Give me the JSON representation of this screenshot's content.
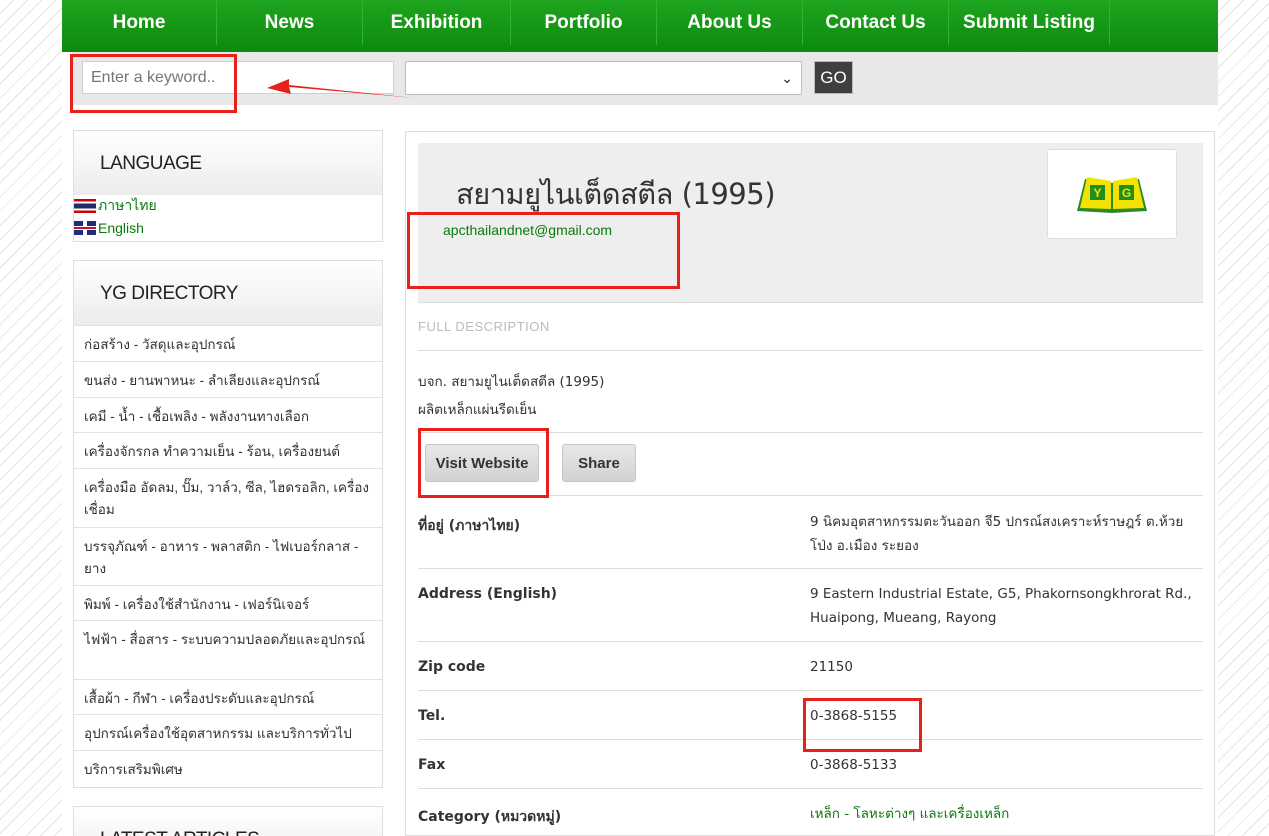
{
  "nav": {
    "items": [
      "Home",
      "News",
      "Exhibition",
      "Portfolio",
      "About Us",
      "Contact Us",
      "Submit Listing"
    ]
  },
  "search": {
    "placeholder": "Enter a keyword..",
    "go_label": "GO",
    "category_value": ""
  },
  "sidebar": {
    "language": {
      "title": "LANGUAGE",
      "items": [
        "ภาษาไทย",
        "English"
      ]
    },
    "directory": {
      "title": "YG DIRECTORY",
      "items": [
        "ก่อสร้าง - วัสดุและอุปกรณ์",
        "ขนส่ง - ยานพาหนะ - ลำเลียงและอุปกรณ์",
        "เคมี - น้ำ - เชื้อเพลิง - พลังงานทางเลือก",
        "เครื่องจักรกล ทำความเย็น - ร้อน, เครื่องยนต์",
        "เครื่องมือ อัดลม, ปั๊ม, วาล์ว, ซีล, ไฮดรอลิก, เครื่องเชื่อม",
        "บรรจุภัณฑ์ - อาหาร - พลาสติก - ไฟเบอร์กลาส - ยาง",
        "พิมพ์ - เครื่องใช้สำนักงาน - เฟอร์นิเจอร์",
        "ไฟฟ้า - สื่อสาร - ระบบความปลอดภัยและอุปกรณ์",
        "เสื้อผ้า - กีฬา - เครื่องประดับและอุปกรณ์",
        "อุปกรณ์เครื่องใช้อุตสาหกรรม และบริการทั่วไป",
        "บริการเสริมพิเศษ"
      ]
    },
    "latest": {
      "title": "LATEST ARTICLES"
    }
  },
  "listing": {
    "company_name": "สยามยูไนเต็ดสตีล (1995)",
    "email": "apcthailandnet@gmail.com",
    "logo_text": "Y G",
    "section_label": "FULL DESCRIPTION",
    "description": [
      "บจก. สยามยูไนเต็ดสตีล (1995)",
      "ผลิตเหล็กแผ่นรีดเย็น"
    ],
    "visit_label": "Visit Website",
    "share_label": "Share",
    "details": [
      {
        "label": "ที่อยู่ (ภาษาไทย)",
        "value": "9 นิคมอุตสาหกรรมตะวันออก จี5 ปกรณ์สงเคราะห์ราษฎร์ ต.ห้วยโป่ง อ.เมือง ระยอง"
      },
      {
        "label": "Address (English)",
        "value": "9 Eastern Industrial Estate, G5, Phakornsongkhrorat Rd., Huaipong, Mueang, Rayong"
      },
      {
        "label": "Zip code",
        "value": "21150"
      },
      {
        "label": "Tel.",
        "value": "0-3868-5155"
      },
      {
        "label": "Fax",
        "value": "0-3868-5133"
      },
      {
        "label": "Category (หมวดหมู่)",
        "value": "เหล็ก - โลหะต่างๆ และเครื่องเหล็ก"
      }
    ]
  },
  "colors": {
    "nav_green": "#129612",
    "link_green": "#0a7a0a",
    "annotation_red": "#e8201a"
  }
}
